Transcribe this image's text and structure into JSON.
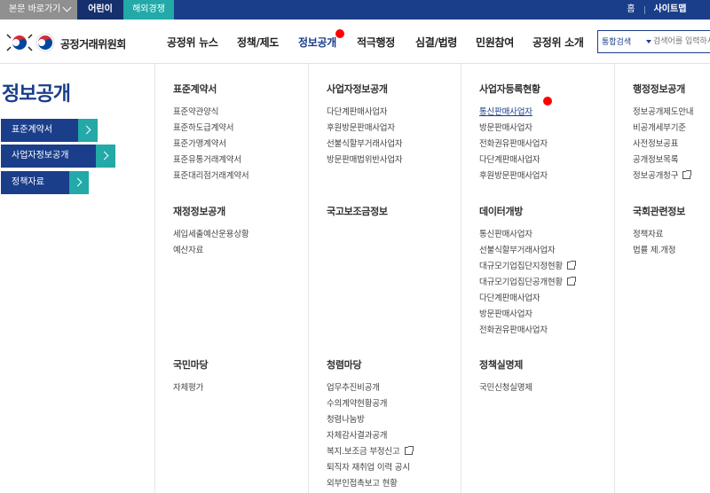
{
  "topbar": {
    "skip_label": "본문 바로가기",
    "kids_label": "어린이",
    "overseas_label": "해외경쟁",
    "home_label": "홈",
    "sitemap_label": "사이트맵"
  },
  "header": {
    "logo_text": "공정거래위원회",
    "nav": [
      "공정위 뉴스",
      "정책/제도",
      "정보공개",
      "적극행정",
      "심결/법령",
      "민원참여",
      "공정위 소개"
    ],
    "active_nav": "정보공개",
    "search": {
      "scope": "통합검색",
      "placeholder": "검색어를 입력하세요"
    }
  },
  "left": {
    "title": "정보공개",
    "buttons": [
      "표준계약서",
      "사업자정보공개",
      "정책자료"
    ]
  },
  "menu": {
    "col1": {
      "sections": [
        {
          "title": "표준계약서",
          "items": [
            "표준약관양식",
            "표준하도급계약서",
            "표준가맹계약서",
            "표준유통거래계약서",
            "표준대리점거래계약서"
          ]
        },
        {
          "title": "재정정보공개",
          "items": [
            "세입세출예산운용상황",
            "예산자료"
          ]
        },
        {
          "title": "국민마당",
          "items": [
            "자체평가"
          ]
        }
      ]
    },
    "col2": {
      "sections": [
        {
          "title": "사업자정보공개",
          "items": [
            "다단계판매사업자",
            "후원방문판매사업자",
            "선불식할부거래사업자",
            "방문판매법위반사업자"
          ]
        },
        {
          "title": "국고보조금정보",
          "items": []
        },
        {
          "title": "청렴마당",
          "items": [
            "업무추진비공개",
            "수의계약현황공개",
            "청렴나눔방",
            "자체감사결과공개",
            "복지.보조금 부정신고",
            "퇴직자 재취업 이력 공시",
            "외부인접촉보고 현황"
          ]
        }
      ]
    },
    "col3": {
      "sections": [
        {
          "title": "사업자등록현황",
          "items": [
            "통신판매사업자",
            "방문판매사업자",
            "전화권유판매사업자",
            "다단계판매사업자",
            "후원방문판매사업자"
          ]
        },
        {
          "title": "데이터개방",
          "items": [
            "통신판매사업자",
            "선불식할부거래사업자",
            "대규모기업집단지정현황",
            "대규모기업집단공개현황",
            "다단계판매사업자",
            "방문판매사업자",
            "전화권유판매사업자"
          ]
        },
        {
          "title": "정책실명제",
          "items": [
            "국민신청실명제"
          ]
        }
      ]
    },
    "col4": {
      "sections": [
        {
          "title": "행정정보공개",
          "items": [
            "정보공개제도안내",
            "비공개세부기준",
            "사전정보공표",
            "공개정보목록",
            "정보공개청구"
          ]
        },
        {
          "title": "국회관련정보",
          "items": [
            "정책자료",
            "법률 제.개정"
          ]
        }
      ]
    }
  }
}
